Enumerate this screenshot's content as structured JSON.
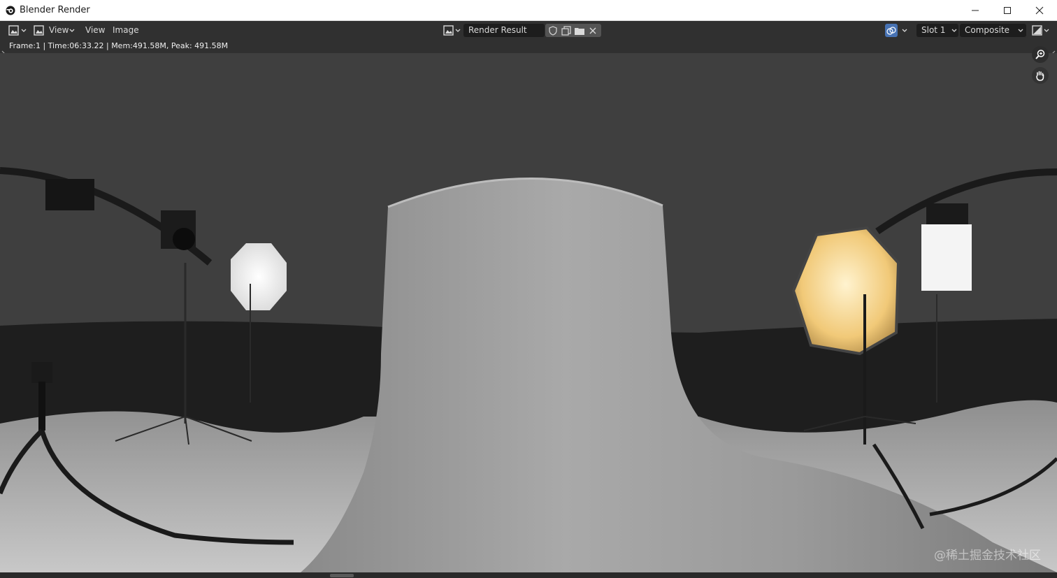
{
  "window": {
    "title": "Blender Render",
    "minimize_icon": "minimize-icon",
    "maximize_icon": "maximize-icon",
    "close_icon": "close-icon"
  },
  "header": {
    "editor_type_icon": "image-editor-icon",
    "menus": [
      "View",
      "View",
      "Image"
    ],
    "image_name": "Render Result",
    "slot": "Slot 1",
    "layer": "Composite"
  },
  "status": {
    "info": "Frame:1 | Time:06:33.22 | Mem:491.58M, Peak: 491.58M"
  },
  "viewport": {
    "description_icon": "render-image"
  },
  "watermark": "@稀土掘金技术社区",
  "colors": {
    "title_bg": "#ffffff",
    "header_bg": "#303030",
    "viewport_bg": "#3c3c3c",
    "accent": "#4772b3"
  }
}
